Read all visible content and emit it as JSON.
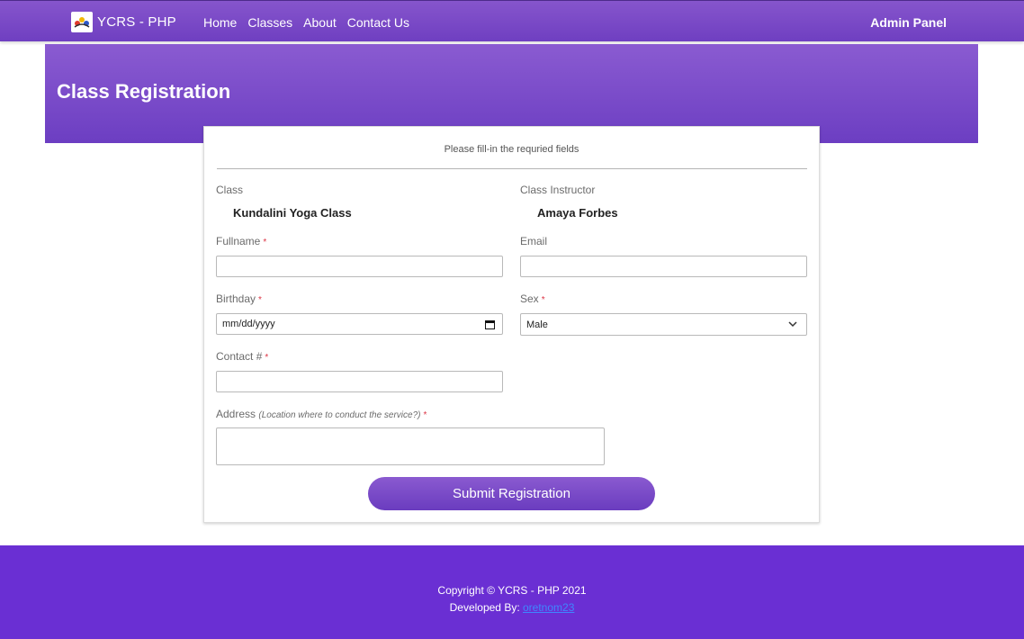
{
  "navbar": {
    "brand": "YCRS - PHP",
    "links": [
      "Home",
      "Classes",
      "About",
      "Contact Us"
    ],
    "admin": "Admin Panel"
  },
  "hero": {
    "title": "Class Registration"
  },
  "form": {
    "note": "Please fill-in the requried fields",
    "class_label": "Class",
    "class_value": "Kundalini Yoga Class",
    "instructor_label": "Class Instructor",
    "instructor_value": "Amaya Forbes",
    "fullname_label": "Fullname",
    "email_label": "Email",
    "birthday_label": "Birthday",
    "birthday_placeholder": "mm/dd/yyyy",
    "sex_label": "Sex",
    "sex_value": "Male",
    "contact_label": "Contact #",
    "address_label": "Address",
    "address_hint": "(Location where to conduct the service?)",
    "required_mark": "*",
    "submit": "Submit Registration"
  },
  "footer": {
    "copyright": "Copyright © YCRS - PHP 2021",
    "developed_by": "Developed By: ",
    "developer": "oretnom23"
  },
  "colors": {
    "primary": "#7047c7",
    "footer": "#6a2fd3",
    "required": "#dc3545",
    "link": "#3f86ff"
  }
}
